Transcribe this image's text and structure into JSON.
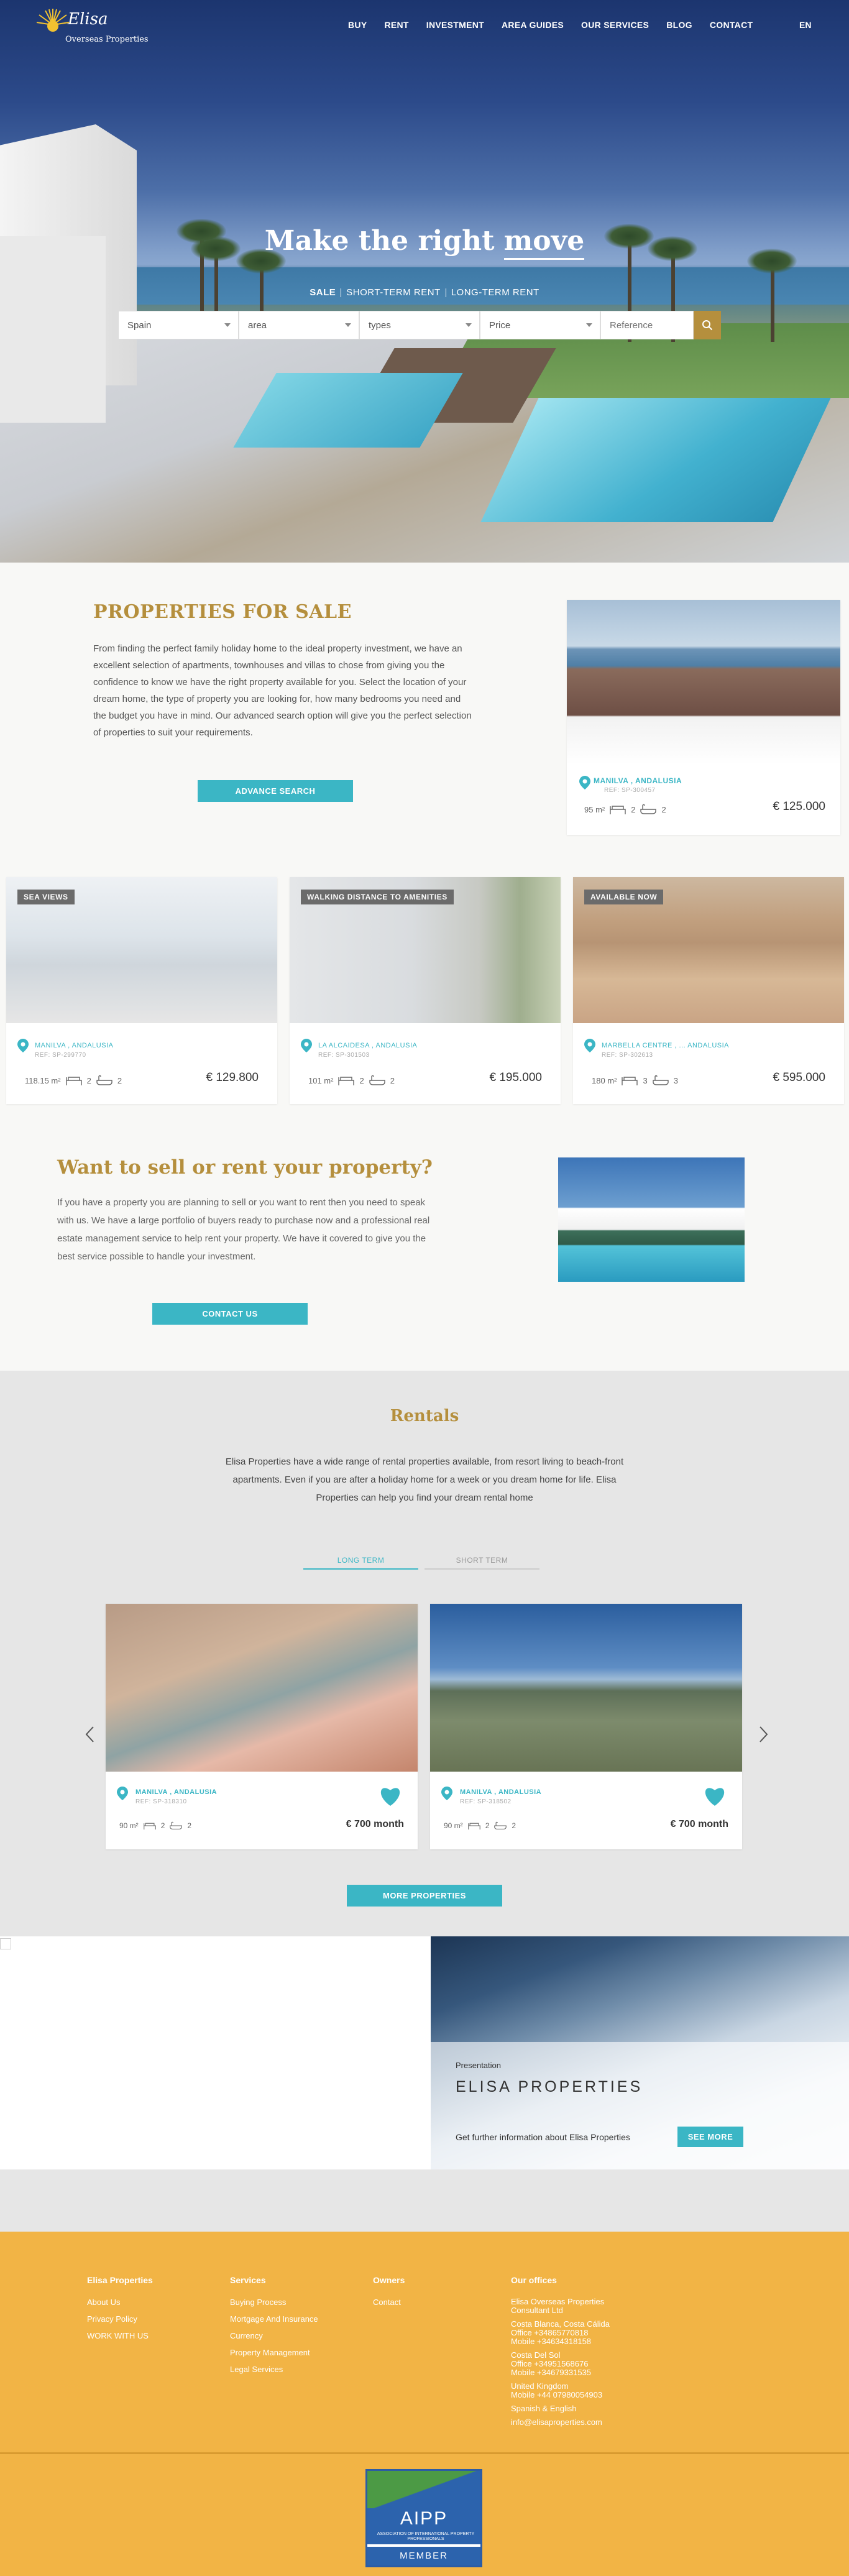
{
  "brand": {
    "name": "Elisa",
    "sub": "Overseas Properties",
    "accent": "#3bb6c5",
    "gold": "#b58f3d",
    "footer_bg": "#f2b445"
  },
  "nav": {
    "items": [
      "BUY",
      "RENT",
      "INVESTMENT",
      "AREA GUIDES",
      "OUR SERVICES",
      "BLOG",
      "CONTACT"
    ],
    "lang": "EN"
  },
  "hero": {
    "title_a": "Make the right ",
    "title_b": "move",
    "tabs": [
      "SALE",
      "SHORT-TERM RENT",
      "LONG-TERM RENT"
    ],
    "search": {
      "country": "Spain",
      "area": "area",
      "types": "types",
      "price": "Price",
      "reference_placeholder": "Reference"
    }
  },
  "sale": {
    "title": "PROPERTIES FOR SALE",
    "text": "From finding the perfect family holiday home to the ideal property investment, we have an excellent selection of apartments, townhouses and villas to chose from giving you the confidence to know we have the right property available for you.  Select the location of your dream home, the type of property you are looking for,  how many bedrooms you need and the budget you have in mind. Our advanced search option will give you the perfect selection of properties to suit your requirements.",
    "button": "ADVANCE SEARCH",
    "featured": {
      "location": "MANILVA , ANDALUSIA",
      "ref": "REF: SP-300457",
      "size": "95 m²",
      "beds": "2",
      "baths": "2",
      "price": "€ 125.000"
    },
    "cards": [
      {
        "badge": "SEA VIEWS",
        "location": "MANILVA , ANDALUSIA",
        "ref": "REF: SP-299770",
        "size": "118.15 m²",
        "beds": "2",
        "baths": "2",
        "price": "€ 129.800"
      },
      {
        "badge": "WALKING DISTANCE TO AMENITIES",
        "location": "LA ALCAIDESA , ANDALUSIA",
        "ref": "REF: SP-301503",
        "size": "101 m²",
        "beds": "2",
        "baths": "2",
        "price": "€ 195.000"
      },
      {
        "badge": "AVAILABLE NOW",
        "location": "MARBELLA CENTRE , ... ANDALUSIA",
        "ref": "REF: SP-302613",
        "size": "180 m²",
        "beds": "3",
        "baths": "3",
        "price": "€ 595.000"
      }
    ]
  },
  "sell": {
    "title": "Want to sell or rent your property?",
    "text": "If you have a property you are planning to sell or you want to rent then you need to speak with us. We have a large portfolio of buyers ready to purchase now and a professional real estate management service to help rent your property. We have it covered to give you the best service possible to handle your investment.",
    "button": "CONTACT US"
  },
  "rentals": {
    "title": "Rentals",
    "text": "Elisa Properties have a wide range of rental properties available, from resort living to beach-front apartments. Even if you are after a holiday home for a week or you dream home for life. Elisa Properties can help you find your dream rental home",
    "tabs": [
      "LONG TERM",
      "SHORT TERM"
    ],
    "cards": [
      {
        "location": "MANILVA , ANDALUSIA",
        "ref": "REF: SP-318310",
        "size": "90 m²",
        "beds": "2",
        "baths": "2",
        "price": "€ 700 month"
      },
      {
        "location": "MANILVA , ANDALUSIA",
        "ref": "REF: SP-318502",
        "size": "90 m²",
        "beds": "2",
        "baths": "2",
        "price": "€ 700 month"
      }
    ],
    "button": "MORE PROPERTIES"
  },
  "presentation": {
    "label": "Presentation",
    "title": "ELISA PROPERTIES",
    "info": "Get further information about Elisa Properties",
    "button": "SEE MORE"
  },
  "footer": {
    "col1": {
      "title": "Elisa Properties",
      "links": [
        "About Us",
        "Privacy Policy",
        "WORK WITH US"
      ]
    },
    "col2": {
      "title": "Services",
      "links": [
        "Buying Process",
        "Mortgage And Insurance",
        "Currency",
        "Property Management",
        "Legal Services"
      ]
    },
    "col3": {
      "title": "Owners",
      "links": [
        "Contact"
      ]
    },
    "col4": {
      "title": "Our offices",
      "company": "Elisa Overseas Properties Consultant Ltd",
      "blanca_1": "Costa Blanca, Costa Cálida",
      "blanca_2": "Office +34865770818",
      "blanca_3": "Mobile +34634318158",
      "sol_1": "Costa Del Sol",
      "sol_2": "Office +34951568676",
      "sol_3": "Mobile +34679331535",
      "uk_1": "United Kingdom",
      "uk_2": "Mobile +44 07980054903",
      "lang": "Spanish & English",
      "email": "info@elisaproperties.com"
    },
    "badge": {
      "name": "AIPP",
      "sub": "ASSOCIATION OF INTERNATIONAL PROPERTY PROFESSIONALS",
      "member": "MEMBER"
    }
  }
}
